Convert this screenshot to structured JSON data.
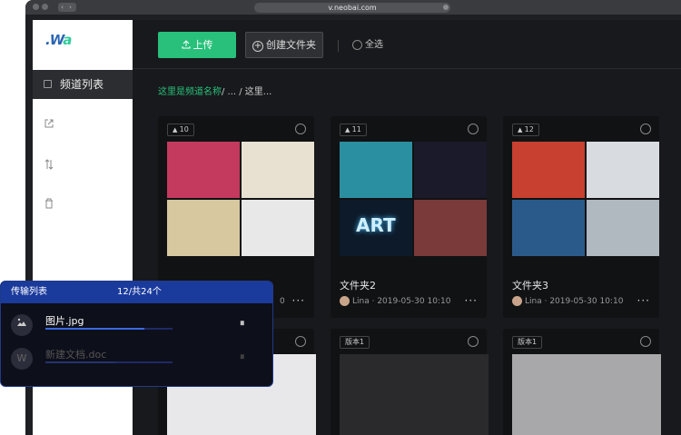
{
  "browser": {
    "url": "v.neobai.com",
    "nav_glyph": "‹ ›"
  },
  "sidebar": {
    "logo_w": ".W",
    "logo_a": "a",
    "items": [
      {
        "label": "频道列表",
        "icon": "grid-icon",
        "active": true
      },
      {
        "icon": "share-icon"
      },
      {
        "icon": "sort-icon"
      },
      {
        "icon": "trash-icon"
      }
    ]
  },
  "toolbar": {
    "upload_label": "上传",
    "new_folder_label": "创建文件夹",
    "select_all_label": "全选"
  },
  "breadcrumb": {
    "link": "这里是频道名称",
    "rest": "/ ... / 这里..."
  },
  "cards": [
    {
      "count": "10",
      "title": "",
      "meta": "",
      "colors": [
        "#c43a5e",
        "#e8e0d0",
        "#d8c8a0",
        "#e8e8e8"
      ]
    },
    {
      "count": "11",
      "title": "文件夹2",
      "meta": "Lina · 2019-05-30 10:10",
      "colors": [
        "#2a8fa0",
        "#1a1a2a",
        "#0d1a2a",
        "#7a3a3a"
      ]
    },
    {
      "count": "12",
      "title": "文件夹3",
      "meta": "Lina · 2019-05-30 10:10",
      "colors": [
        "#c84030",
        "#d8dce0",
        "#2a5a8a",
        "#b0b8c0"
      ]
    },
    {
      "count": "",
      "title": "",
      "meta": "",
      "colors": [
        "#e8e8ea"
      ]
    },
    {
      "count": "版本1",
      "title": "",
      "meta": "",
      "colors": [
        "#2a2a2c"
      ]
    },
    {
      "count": "版本1",
      "title": "",
      "meta": "",
      "colors": [
        "#a8a8aa"
      ]
    }
  ],
  "card_extra": {
    "partial_meta_tail": "0",
    "more_glyph": "···"
  },
  "art_text": "ART",
  "transfer": {
    "title": "传输列表",
    "count": "12/共24个",
    "items": [
      {
        "name": "图片.jpg",
        "icon": "image-icon",
        "progress": 0.78,
        "active": true
      },
      {
        "name": "新建文档.doc",
        "icon": "word-icon",
        "progress": 0.55,
        "active": false
      }
    ],
    "pause_glyph": "⏸",
    "word_glyph": "W"
  }
}
